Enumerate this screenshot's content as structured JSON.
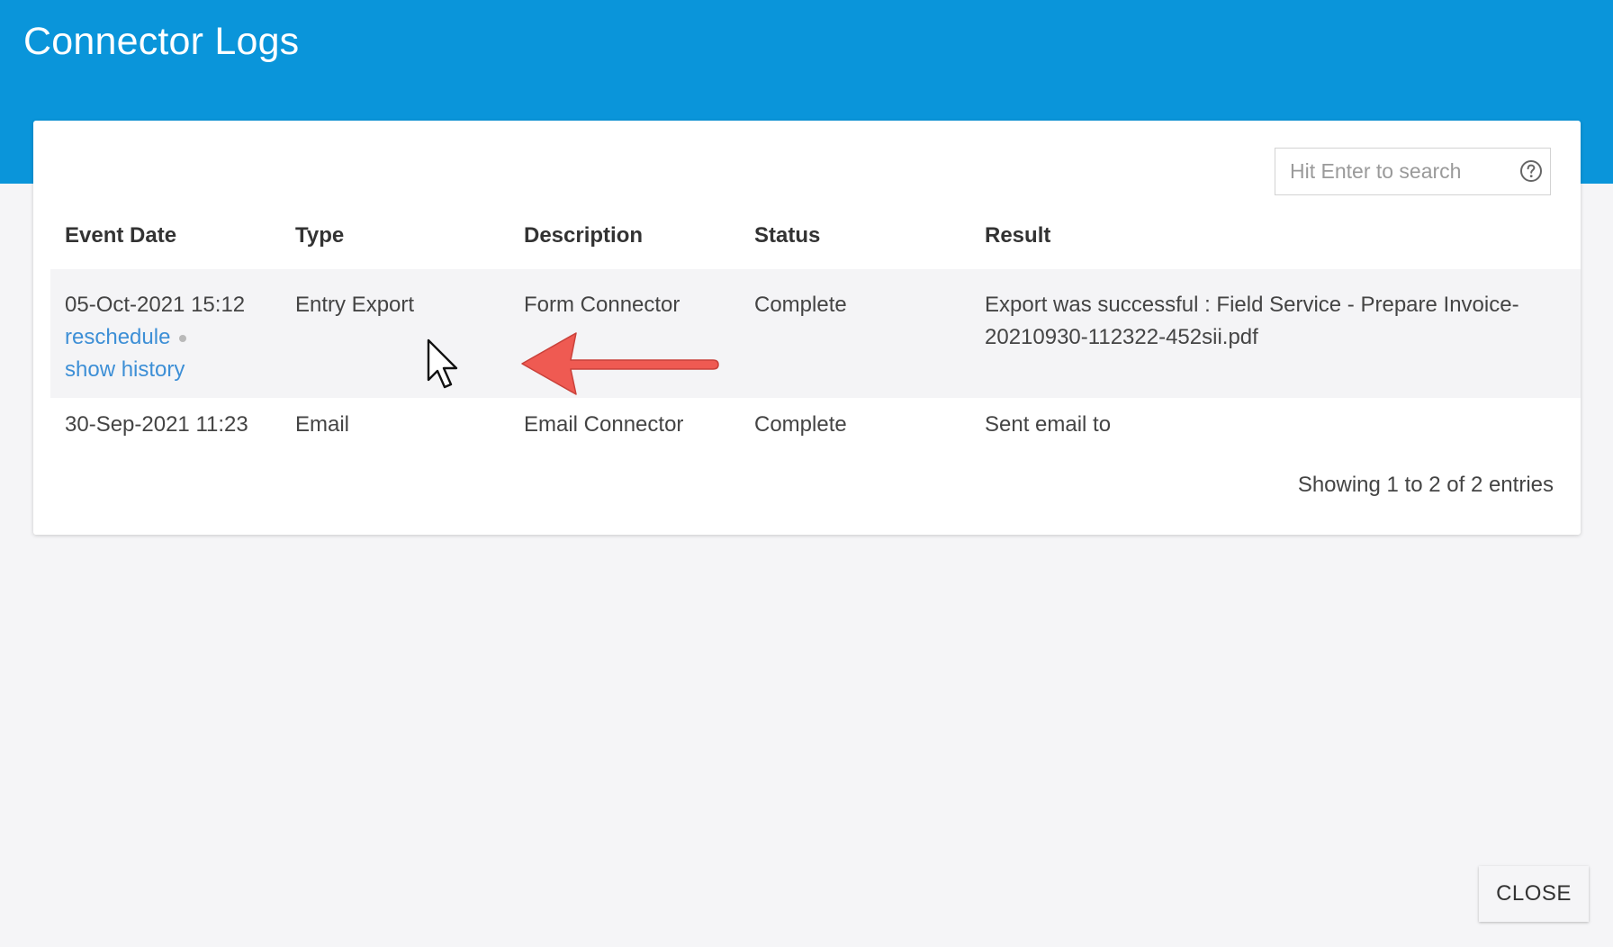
{
  "header": {
    "title": "Connector Logs"
  },
  "search": {
    "placeholder": "Hit Enter to search",
    "value": ""
  },
  "table": {
    "columns": [
      "Event Date",
      "Type",
      "Description",
      "Status",
      "Result"
    ],
    "rows": [
      {
        "event_date": "05-Oct-2021 15:12",
        "reschedule_link": "reschedule",
        "history_link": "show history",
        "type": "Entry Export",
        "description": "Form Connector",
        "status": "Complete",
        "result": "Export was successful : Field Service - Prepare Invoice-20210930-112322-452sii.pdf"
      },
      {
        "event_date": "30-Sep-2021 11:23",
        "type": "Email",
        "description": "Email Connector",
        "status": "Complete",
        "result": "Sent email to"
      }
    ],
    "entries_info": "Showing 1 to 2 of 2 entries"
  },
  "footer": {
    "close_label": "CLOSE"
  },
  "colors": {
    "header_blue": "#0a95da",
    "link_blue": "#3d8fd6",
    "arrow_red": "#ef5a52"
  },
  "icons": {
    "help": "help-circle-icon",
    "cursor": "mouse-pointer-icon",
    "annotation": "left-arrow-annotation-icon"
  }
}
